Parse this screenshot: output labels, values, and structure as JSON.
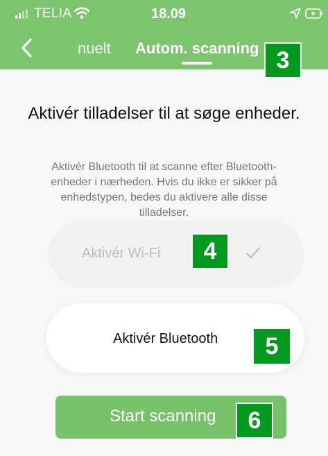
{
  "status_bar": {
    "carrier": "TELIA",
    "time": "18.09"
  },
  "nav": {
    "tab_manual_partial": "nuelt",
    "tab_auto": "Autom. scanning"
  },
  "content": {
    "title": "Aktivér tilladelser til at søge enheder.",
    "description": "Aktivér Bluetooth til at scanne efter Bluetooth-enheder i nærheden. Hvis du ikke er sikker på enhedstypen, bedes du aktivere alle disse tilladelser.",
    "wifi_button": "Aktivér Wi-Fi",
    "bluetooth_button": "Aktivér Bluetooth",
    "start_button": "Start scanning"
  },
  "annotations": {
    "badge_3": "3",
    "badge_4": "4",
    "badge_5": "5",
    "badge_6": "6"
  },
  "colors": {
    "header": "#7cc46e",
    "button": "#77c16a",
    "badge": "#06991f",
    "background": "#f7f7f7"
  },
  "icons": {
    "back": "chevron-left-icon",
    "wifi_status": "wifi-icon",
    "location": "location-arrow-icon",
    "battery": "battery-charging-icon",
    "check": "check-icon"
  }
}
